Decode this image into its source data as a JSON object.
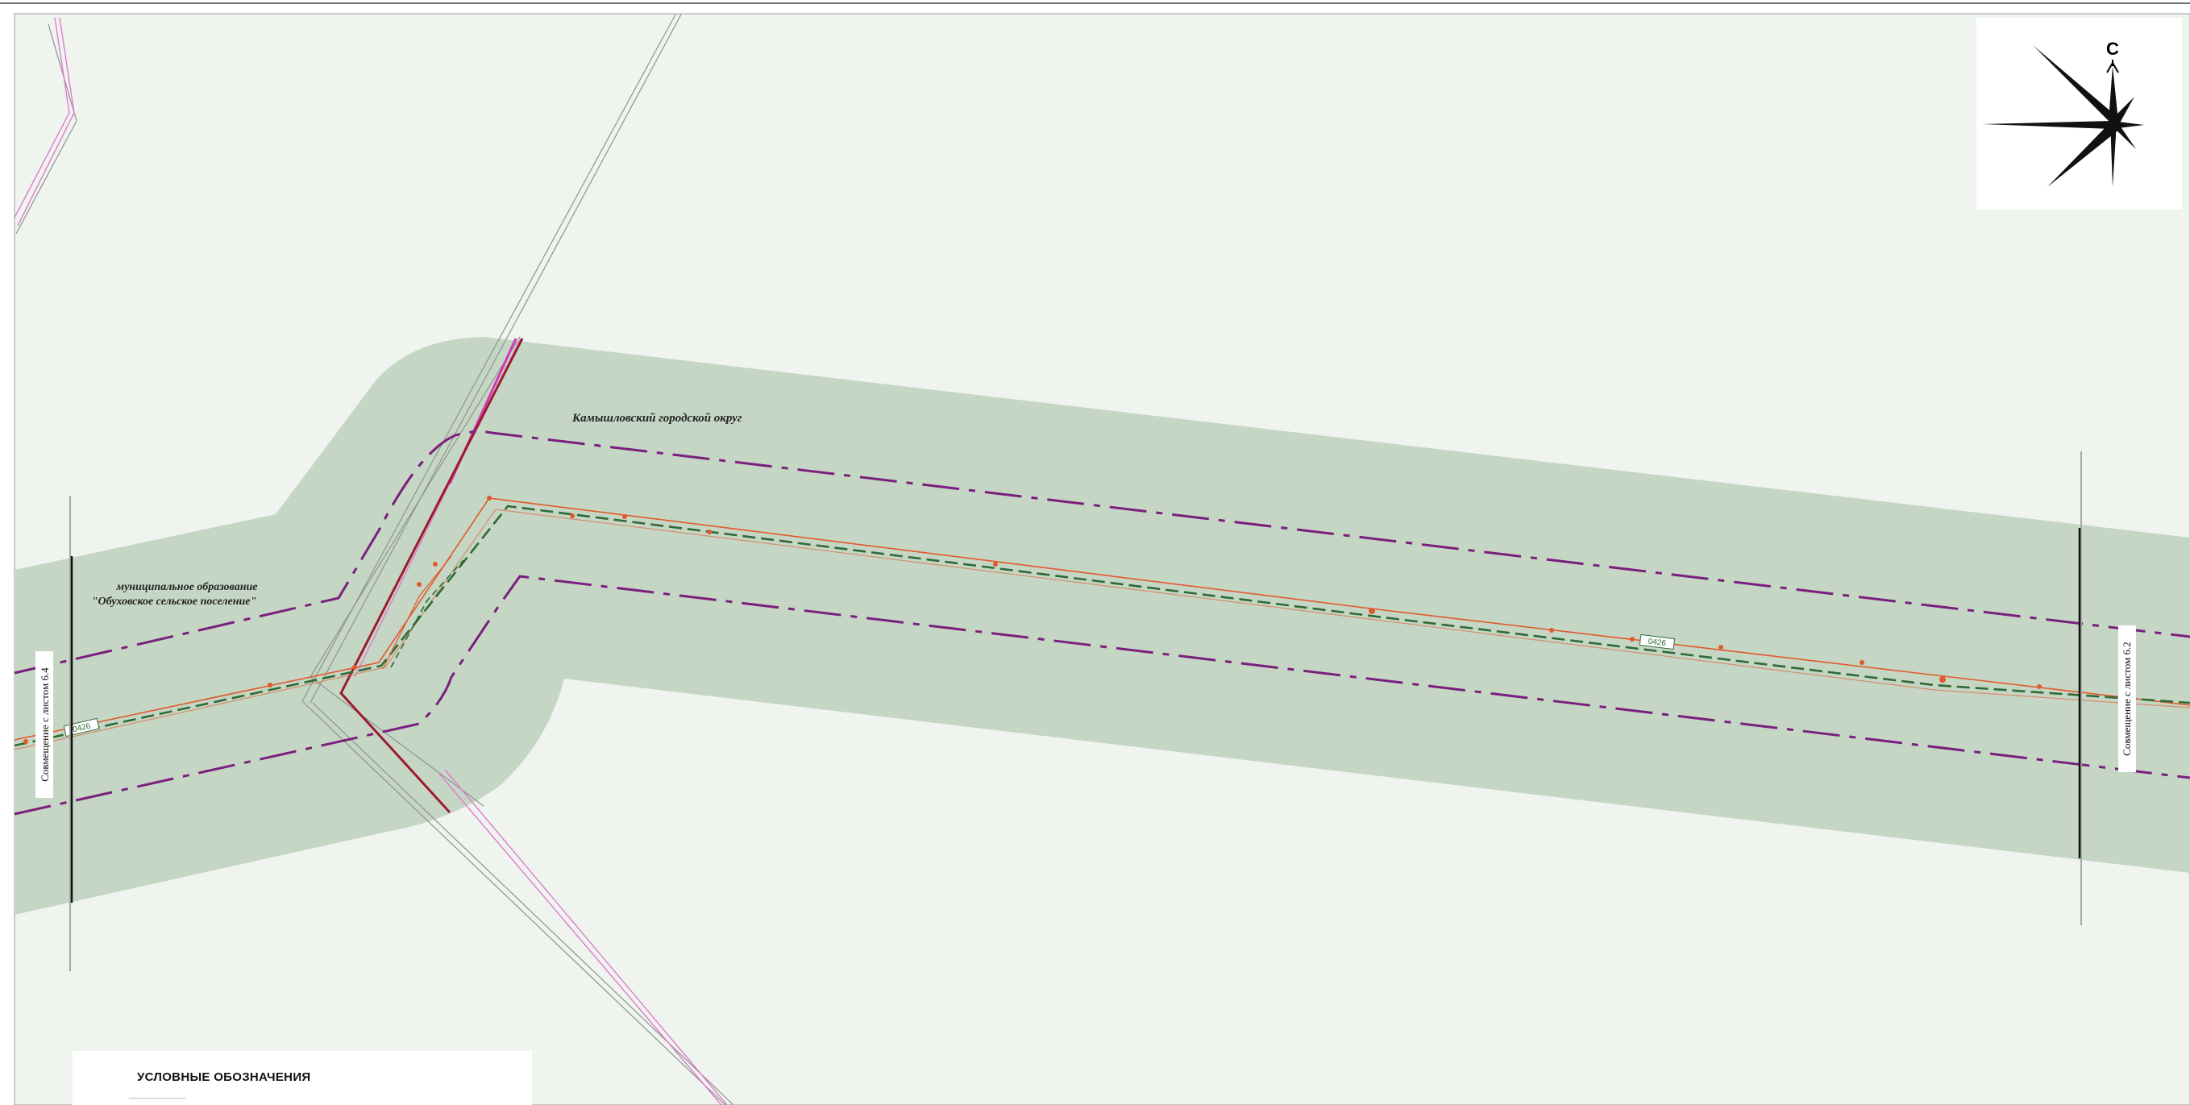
{
  "map": {
    "labels": {
      "district": "Камышловский городской округ",
      "municipality_line1": "муниципальное образование",
      "municipality_line2": "\"Обуховское сельское поселение\""
    },
    "sheet_links": {
      "left": "Совмещение с листом 6.4",
      "right": "Совмещение с листом 6.2"
    },
    "pipeline_tags": [
      "0426",
      "0426"
    ],
    "compass": {
      "north_letter": "С"
    },
    "legend": {
      "title": "УСЛОВНЫЕ ОБОЗНАЧЕНИЯ"
    },
    "colors": {
      "background": "#eff4ef",
      "zone_fill": "#c6d6c5",
      "boundary_purple": "#7a1f7d",
      "pipeline_orange": "#e05a2c",
      "axis_green": "#2e6b35",
      "road_red": "#9b1b30",
      "pink_line": "#e07ad0"
    }
  }
}
